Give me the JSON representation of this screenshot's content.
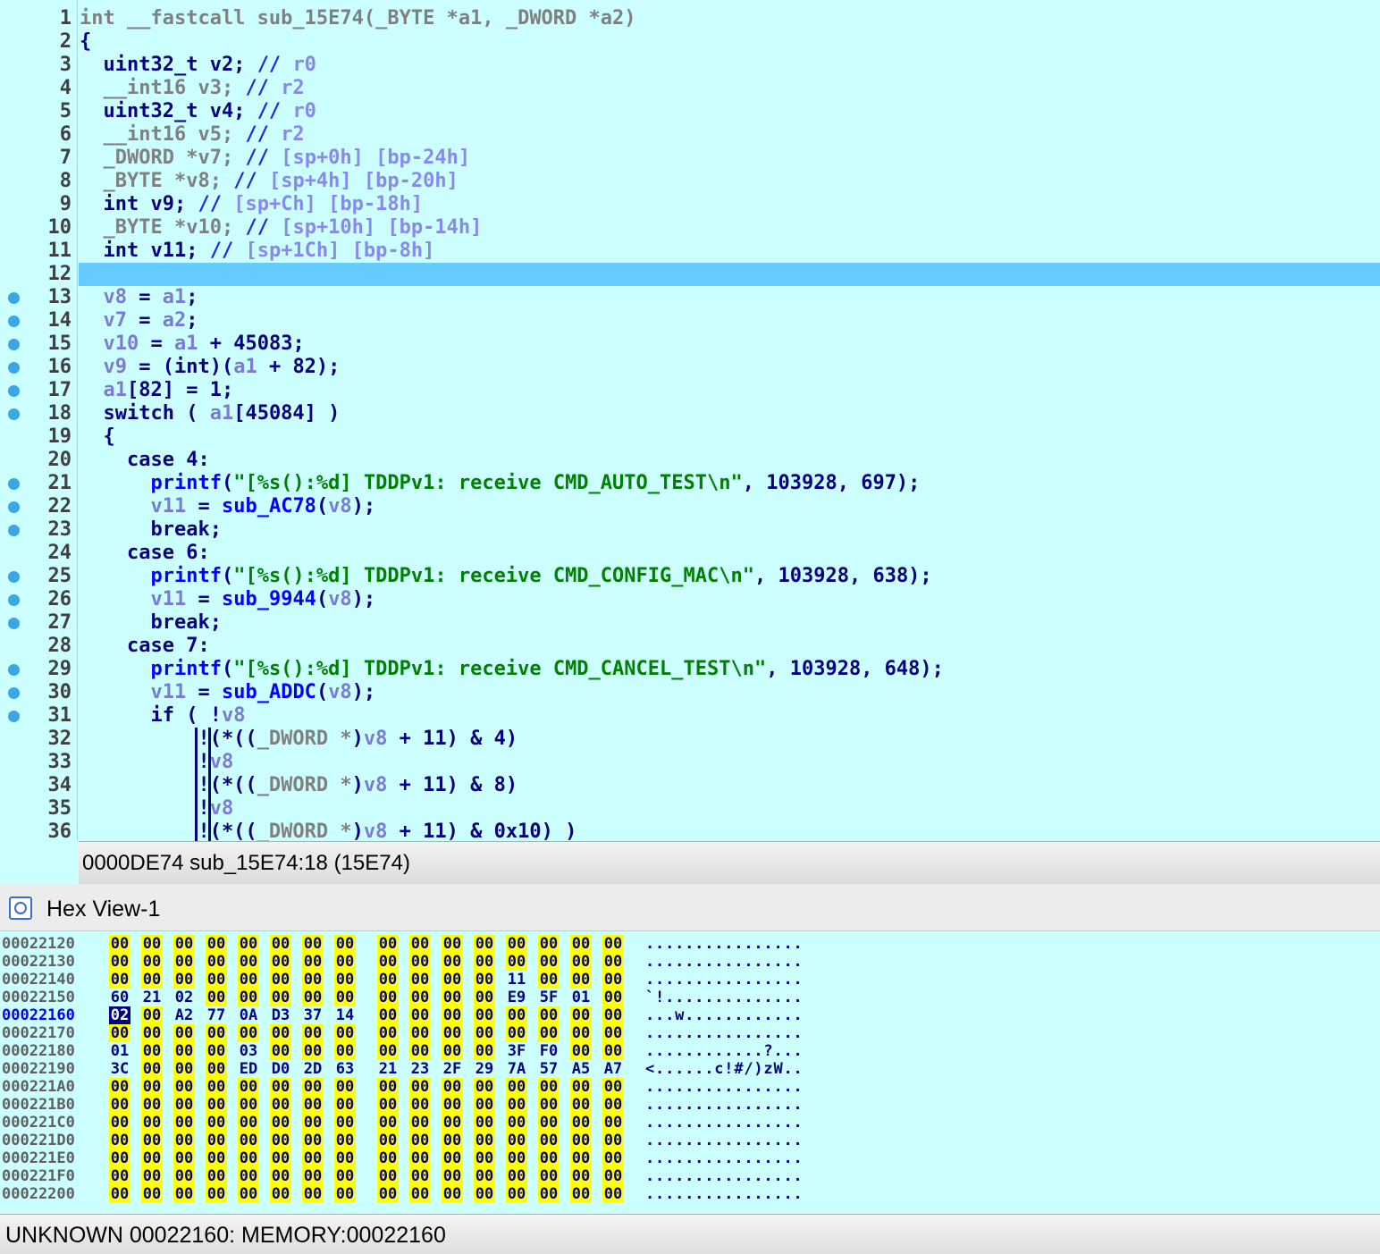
{
  "pseudocode": {
    "lines": [
      {
        "n": "1",
        "dot": false,
        "tokens": [
          [
            "gray",
            "int __fastcall sub_15E74(_BYTE *a1, _DWORD *a2)"
          ]
        ]
      },
      {
        "n": "2",
        "dot": false,
        "tokens": [
          [
            "punc",
            "{"
          ]
        ]
      },
      {
        "n": "3",
        "dot": false,
        "tokens": [
          [
            "kw",
            "  uint32_t v2; "
          ],
          [
            "cmt",
            "// "
          ],
          [
            "cmtv",
            "r0"
          ]
        ]
      },
      {
        "n": "4",
        "dot": false,
        "tokens": [
          [
            "gray",
            "  __int16 "
          ],
          [
            "gray",
            "v3; "
          ],
          [
            "cmt",
            "// "
          ],
          [
            "cmtv",
            "r2"
          ]
        ]
      },
      {
        "n": "5",
        "dot": false,
        "tokens": [
          [
            "kw",
            "  uint32_t v4; "
          ],
          [
            "cmt",
            "// "
          ],
          [
            "cmtv",
            "r0"
          ]
        ]
      },
      {
        "n": "6",
        "dot": false,
        "tokens": [
          [
            "gray",
            "  __int16 "
          ],
          [
            "gray",
            "v5; "
          ],
          [
            "cmt",
            "// "
          ],
          [
            "cmtv",
            "r2"
          ]
        ]
      },
      {
        "n": "7",
        "dot": false,
        "tokens": [
          [
            "gray",
            "  _DWORD "
          ],
          [
            "gray",
            "*v7; "
          ],
          [
            "cmt",
            "// "
          ],
          [
            "cmtv",
            "[sp+0h] [bp-24h]"
          ]
        ]
      },
      {
        "n": "8",
        "dot": false,
        "tokens": [
          [
            "gray",
            "  _BYTE "
          ],
          [
            "gray",
            "*v8; "
          ],
          [
            "cmt",
            "// "
          ],
          [
            "cmtv",
            "[sp+4h] [bp-20h]"
          ]
        ]
      },
      {
        "n": "9",
        "dot": false,
        "tokens": [
          [
            "kw",
            "  int v9; "
          ],
          [
            "cmt",
            "// "
          ],
          [
            "cmtv",
            "[sp+Ch] [bp-18h]"
          ]
        ]
      },
      {
        "n": "10",
        "dot": false,
        "tokens": [
          [
            "gray",
            "  _BYTE "
          ],
          [
            "gray",
            "*v10; "
          ],
          [
            "cmt",
            "// "
          ],
          [
            "cmtv",
            "[sp+10h] [bp-14h]"
          ]
        ]
      },
      {
        "n": "11",
        "dot": false,
        "tokens": [
          [
            "kw",
            "  int v11; "
          ],
          [
            "cmt",
            "// "
          ],
          [
            "cmtv",
            "[sp+1Ch] [bp-8h]"
          ]
        ]
      },
      {
        "n": "12",
        "dot": false,
        "tokens": []
      },
      {
        "n": "13",
        "dot": true,
        "tokens": [
          [
            "var",
            "  v8"
          ],
          [
            "punc",
            " = "
          ],
          [
            "var",
            "a1"
          ],
          [
            "punc",
            ";"
          ]
        ]
      },
      {
        "n": "14",
        "dot": true,
        "tokens": [
          [
            "var",
            "  v7"
          ],
          [
            "punc",
            " = "
          ],
          [
            "var",
            "a2"
          ],
          [
            "punc",
            ";"
          ]
        ]
      },
      {
        "n": "15",
        "dot": true,
        "tokens": [
          [
            "var",
            "  v10"
          ],
          [
            "punc",
            " = "
          ],
          [
            "var",
            "a1"
          ],
          [
            "punc",
            " + 45083;"
          ]
        ]
      },
      {
        "n": "16",
        "dot": true,
        "tokens": [
          [
            "var",
            "  v9"
          ],
          [
            "punc",
            " = (int)("
          ],
          [
            "var",
            "a1"
          ],
          [
            "punc",
            " + 82);"
          ]
        ]
      },
      {
        "n": "17",
        "dot": true,
        "tokens": [
          [
            "var",
            "  a1"
          ],
          [
            "punc",
            "[82] = 1;"
          ]
        ]
      },
      {
        "n": "18",
        "dot": true,
        "tokens": [
          [
            "kw",
            "  switch ( "
          ],
          [
            "var",
            "a1"
          ],
          [
            "punc",
            "[45084] )"
          ]
        ]
      },
      {
        "n": "19",
        "dot": false,
        "tokens": [
          [
            "punc",
            "  {"
          ]
        ]
      },
      {
        "n": "20",
        "dot": false,
        "tokens": [
          [
            "kw",
            "    case 4:"
          ]
        ]
      },
      {
        "n": "21",
        "dot": true,
        "tokens": [
          [
            "fn",
            "      printf"
          ],
          [
            "punc",
            "("
          ],
          [
            "str",
            "\"[%s():%d] TDDPv1: receive CMD_AUTO_TEST\\n\""
          ],
          [
            "punc",
            ", 103928, 697);"
          ]
        ]
      },
      {
        "n": "22",
        "dot": true,
        "tokens": [
          [
            "var",
            "      v11"
          ],
          [
            "punc",
            " = "
          ],
          [
            "fn",
            "sub_AC78"
          ],
          [
            "punc",
            "("
          ],
          [
            "var",
            "v8"
          ],
          [
            "punc",
            ");"
          ]
        ]
      },
      {
        "n": "23",
        "dot": true,
        "tokens": [
          [
            "kw",
            "      break;"
          ]
        ]
      },
      {
        "n": "24",
        "dot": false,
        "tokens": [
          [
            "kw",
            "    case 6:"
          ]
        ]
      },
      {
        "n": "25",
        "dot": true,
        "tokens": [
          [
            "fn",
            "      printf"
          ],
          [
            "punc",
            "("
          ],
          [
            "str",
            "\"[%s():%d] TDDPv1: receive CMD_CONFIG_MAC\\n\""
          ],
          [
            "punc",
            ", 103928, 638);"
          ]
        ]
      },
      {
        "n": "26",
        "dot": true,
        "tokens": [
          [
            "var",
            "      v11"
          ],
          [
            "punc",
            " = "
          ],
          [
            "fn",
            "sub_9944"
          ],
          [
            "punc",
            "("
          ],
          [
            "var",
            "v8"
          ],
          [
            "punc",
            ");"
          ]
        ]
      },
      {
        "n": "27",
        "dot": true,
        "tokens": [
          [
            "kw",
            "      break;"
          ]
        ]
      },
      {
        "n": "28",
        "dot": false,
        "tokens": [
          [
            "kw",
            "    case 7:"
          ]
        ]
      },
      {
        "n": "29",
        "dot": true,
        "tokens": [
          [
            "fn",
            "      printf"
          ],
          [
            "punc",
            "("
          ],
          [
            "str",
            "\"[%s():%d] TDDPv1: receive CMD_CANCEL_TEST\\n\""
          ],
          [
            "punc",
            ", 103928, 648);"
          ]
        ]
      },
      {
        "n": "30",
        "dot": true,
        "tokens": [
          [
            "var",
            "      v11"
          ],
          [
            "punc",
            " = "
          ],
          [
            "fn",
            "sub_ADDC"
          ],
          [
            "punc",
            "("
          ],
          [
            "var",
            "v8"
          ],
          [
            "punc",
            ");"
          ]
        ]
      },
      {
        "n": "31",
        "dot": true,
        "tokens": [
          [
            "kw",
            "      if ( "
          ],
          [
            "punc",
            "!"
          ],
          [
            "var",
            "v8"
          ]
        ]
      },
      {
        "n": "32",
        "dot": false,
        "tokens": [
          [
            "punc",
            "          !(*(("
          ],
          [
            "gray",
            "_DWORD *"
          ],
          [
            "punc",
            ")"
          ],
          [
            "var",
            "v8"
          ],
          [
            "punc",
            " + 11) & 4)"
          ]
        ]
      },
      {
        "n": "33",
        "dot": false,
        "tokens": [
          [
            "punc",
            "          !"
          ],
          [
            "var",
            "v8"
          ]
        ]
      },
      {
        "n": "34",
        "dot": false,
        "tokens": [
          [
            "punc",
            "          !(*(("
          ],
          [
            "gray",
            "_DWORD *"
          ],
          [
            "punc",
            ")"
          ],
          [
            "var",
            "v8"
          ],
          [
            "punc",
            " + 11) & 8)"
          ]
        ]
      },
      {
        "n": "35",
        "dot": false,
        "tokens": [
          [
            "punc",
            "          !"
          ],
          [
            "var",
            "v8"
          ]
        ]
      },
      {
        "n": "36",
        "dot": false,
        "tokens": [
          [
            "punc",
            "          !(*(("
          ],
          [
            "gray",
            "_DWORD *"
          ],
          [
            "punc",
            ")"
          ],
          [
            "var",
            "v8"
          ],
          [
            "punc",
            " + 11) & 0x10) )"
          ]
        ]
      }
    ],
    "current_line": "12",
    "status": "0000DE74  sub_15E74:18 (15E74)"
  },
  "hexview": {
    "title": "Hex View-1",
    "rows": [
      {
        "addr": "00022120",
        "bytes": [
          "00",
          "00",
          "00",
          "00",
          "00",
          "00",
          "00",
          "00",
          "00",
          "00",
          "00",
          "00",
          "00",
          "00",
          "00",
          "00"
        ],
        "ascii": "................"
      },
      {
        "addr": "00022130",
        "bytes": [
          "00",
          "00",
          "00",
          "00",
          "00",
          "00",
          "00",
          "00",
          "00",
          "00",
          "00",
          "00",
          "00",
          "00",
          "00",
          "00"
        ],
        "ascii": "................"
      },
      {
        "addr": "00022140",
        "bytes": [
          "00",
          "00",
          "00",
          "00",
          "00",
          "00",
          "00",
          "00",
          "00",
          "00",
          "00",
          "00",
          "11",
          "00",
          "00",
          "00"
        ],
        "ascii": "................"
      },
      {
        "addr": "00022150",
        "bytes": [
          "60",
          "21",
          "02",
          "00",
          "00",
          "00",
          "00",
          "00",
          "00",
          "00",
          "00",
          "00",
          "E9",
          "5F",
          "01",
          "00"
        ],
        "ascii": "`!.............."
      },
      {
        "addr": "00022160",
        "bytes": [
          "02",
          "00",
          "A2",
          "77",
          "0A",
          "D3",
          "37",
          "14",
          "00",
          "00",
          "00",
          "00",
          "00",
          "00",
          "00",
          "00"
        ],
        "ascii": "...w............"
      },
      {
        "addr": "00022170",
        "bytes": [
          "00",
          "00",
          "00",
          "00",
          "00",
          "00",
          "00",
          "00",
          "00",
          "00",
          "00",
          "00",
          "00",
          "00",
          "00",
          "00"
        ],
        "ascii": "................"
      },
      {
        "addr": "00022180",
        "bytes": [
          "01",
          "00",
          "00",
          "00",
          "03",
          "00",
          "00",
          "00",
          "00",
          "00",
          "00",
          "00",
          "3F",
          "F0",
          "00",
          "00"
        ],
        "ascii": "............?..."
      },
      {
        "addr": "00022190",
        "bytes": [
          "3C",
          "00",
          "00",
          "00",
          "ED",
          "D0",
          "2D",
          "63",
          "21",
          "23",
          "2F",
          "29",
          "7A",
          "57",
          "A5",
          "A7"
        ],
        "ascii": "<......c!#/)zW.."
      },
      {
        "addr": "000221A0",
        "bytes": [
          "00",
          "00",
          "00",
          "00",
          "00",
          "00",
          "00",
          "00",
          "00",
          "00",
          "00",
          "00",
          "00",
          "00",
          "00",
          "00"
        ],
        "ascii": "................"
      },
      {
        "addr": "000221B0",
        "bytes": [
          "00",
          "00",
          "00",
          "00",
          "00",
          "00",
          "00",
          "00",
          "00",
          "00",
          "00",
          "00",
          "00",
          "00",
          "00",
          "00"
        ],
        "ascii": "................"
      },
      {
        "addr": "000221C0",
        "bytes": [
          "00",
          "00",
          "00",
          "00",
          "00",
          "00",
          "00",
          "00",
          "00",
          "00",
          "00",
          "00",
          "00",
          "00",
          "00",
          "00"
        ],
        "ascii": "................"
      },
      {
        "addr": "000221D0",
        "bytes": [
          "00",
          "00",
          "00",
          "00",
          "00",
          "00",
          "00",
          "00",
          "00",
          "00",
          "00",
          "00",
          "00",
          "00",
          "00",
          "00"
        ],
        "ascii": "................"
      },
      {
        "addr": "000221E0",
        "bytes": [
          "00",
          "00",
          "00",
          "00",
          "00",
          "00",
          "00",
          "00",
          "00",
          "00",
          "00",
          "00",
          "00",
          "00",
          "00",
          "00"
        ],
        "ascii": "................"
      },
      {
        "addr": "000221F0",
        "bytes": [
          "00",
          "00",
          "00",
          "00",
          "00",
          "00",
          "00",
          "00",
          "00",
          "00",
          "00",
          "00",
          "00",
          "00",
          "00",
          "00"
        ],
        "ascii": "................"
      },
      {
        "addr": "00022200",
        "bytes": [
          "00",
          "00",
          "00",
          "00",
          "00",
          "00",
          "00",
          "00",
          "00",
          "00",
          "00",
          "00",
          "00",
          "00",
          "00",
          "00"
        ],
        "ascii": "................"
      }
    ],
    "selected_addr": "00022160",
    "status": "UNKNOWN  00022160: MEMORY:00022160"
  },
  "colors": {
    "background": "#ccffff",
    "current_line": "#66ccff",
    "zero_byte": "#ffff00",
    "selection": "#000080"
  }
}
